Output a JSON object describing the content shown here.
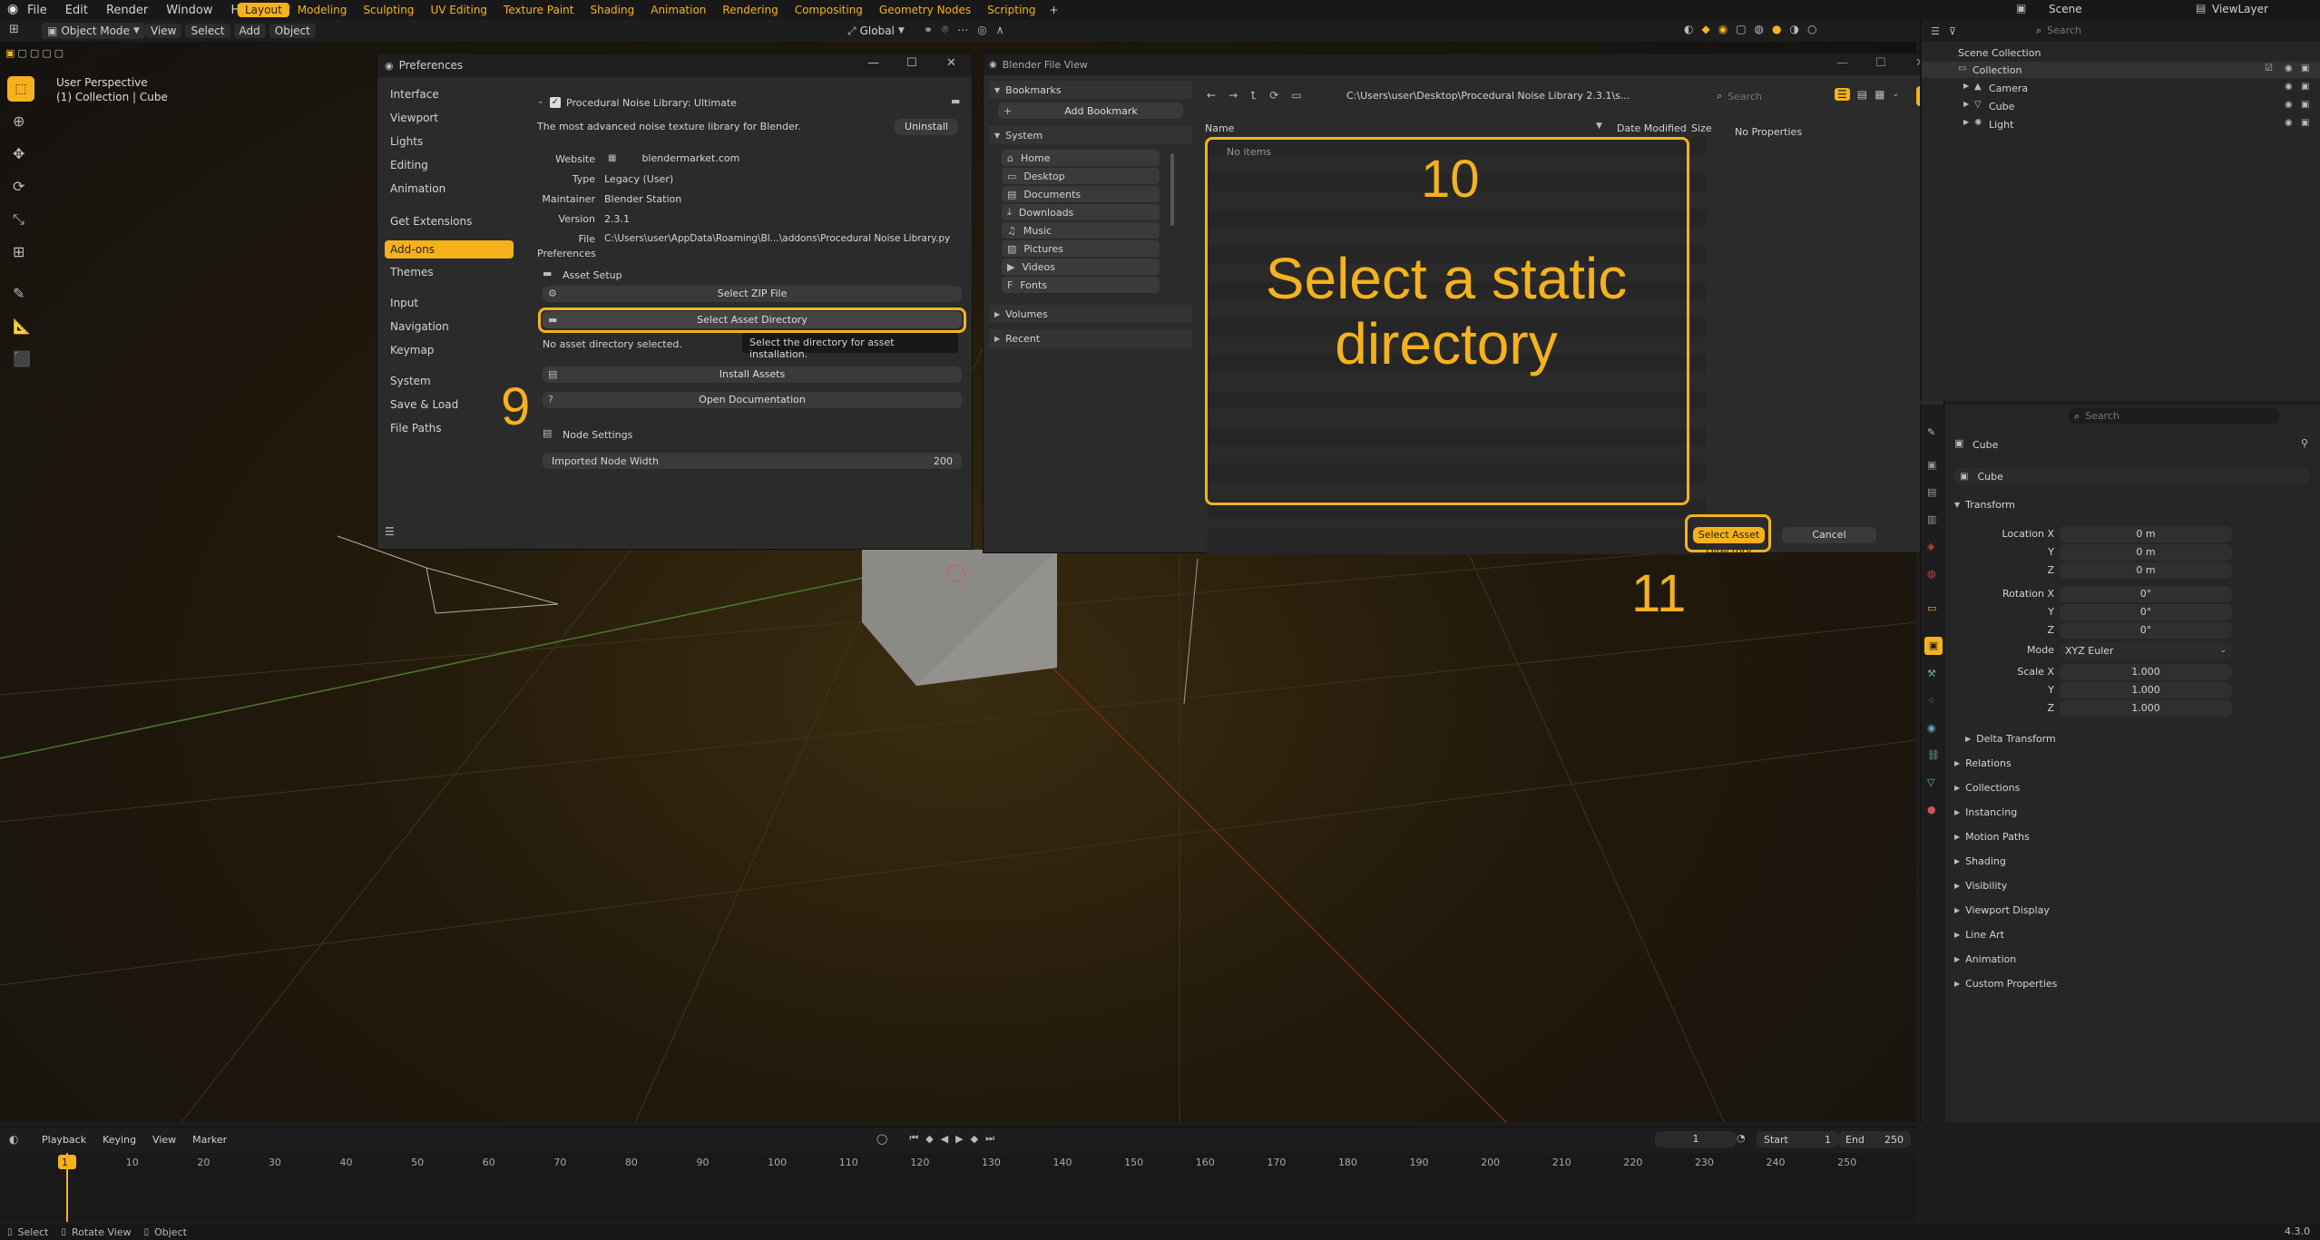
{
  "topbar": {
    "menus": [
      "File",
      "Edit",
      "Render",
      "Window",
      "Help"
    ],
    "tabs": [
      "Layout",
      "Modeling",
      "Sculpting",
      "UV Editing",
      "Texture Paint",
      "Shading",
      "Animation",
      "Rendering",
      "Compositing",
      "Geometry Nodes",
      "Scripting"
    ],
    "add_tab": "+",
    "scene": "Scene",
    "view_layer": "ViewLayer"
  },
  "viewport_header": {
    "mode": "Object Mode",
    "menus": [
      "View",
      "Select",
      "Add",
      "Object"
    ],
    "orientation": "Global"
  },
  "viewport": {
    "perspective": "User Perspective",
    "collection": "(1) Collection | Cube"
  },
  "annotations": {
    "nine": "9",
    "ten": "10",
    "ten_text": "Select a static directory",
    "eleven": "11"
  },
  "preferences": {
    "title": "Preferences",
    "nav": [
      {
        "label": "Interface"
      },
      {
        "label": "Viewport"
      },
      {
        "label": "Lights"
      },
      {
        "label": "Editing"
      },
      {
        "label": "Animation"
      },
      {
        "label": "Get Extensions"
      },
      {
        "label": "Add-ons"
      },
      {
        "label": "Themes"
      },
      {
        "label": "Input"
      },
      {
        "label": "Navigation"
      },
      {
        "label": "Keymap"
      },
      {
        "label": "System"
      },
      {
        "label": "Save & Load"
      },
      {
        "label": "File Paths"
      }
    ],
    "addon_name": "Procedural Noise Library: Ultimate",
    "description": "The most advanced noise texture library for Blender.",
    "uninstall": "Uninstall",
    "website_label": "Website",
    "website": "blendermarket.com",
    "type_label": "Type",
    "type": "Legacy (User)",
    "maintainer_label": "Maintainer",
    "maintainer": "Blender Station",
    "version_label": "Version",
    "version": "2.3.1",
    "file_label": "File",
    "file": "C:\\Users\\user\\AppData\\Roaming\\Bl...\\addons\\Procedural Noise Library.py",
    "prefs_heading": "Preferences",
    "asset_setup": "Asset Setup",
    "select_zip": "Select ZIP File",
    "select_asset_dir": "Select Asset Directory",
    "no_dir": "No asset directory selected.",
    "tooltip": "Select the directory for asset installation.",
    "install_assets": "Install Assets",
    "open_docs": "Open Documentation",
    "node_settings": "Node Settings",
    "node_width_label": "Imported Node Width",
    "node_width": "200"
  },
  "file_view": {
    "title": "Blender File View",
    "bookmarks": "Bookmarks",
    "add_bookmark": "Add Bookmark",
    "system": "System",
    "system_items": [
      {
        "label": "Home",
        "icon": "home-icon"
      },
      {
        "label": "Desktop",
        "icon": "desktop-icon"
      },
      {
        "label": "Documents",
        "icon": "documents-icon"
      },
      {
        "label": "Downloads",
        "icon": "downloads-icon"
      },
      {
        "label": "Music",
        "icon": "music-icon"
      },
      {
        "label": "Pictures",
        "icon": "pictures-icon"
      },
      {
        "label": "Videos",
        "icon": "videos-icon"
      },
      {
        "label": "Fonts",
        "icon": "fonts-icon"
      }
    ],
    "volumes": "Volumes",
    "recent": "Recent",
    "path": "C:\\Users\\user\\Desktop\\Procedural Noise Library 2.3.1\\s...",
    "search_placeholder": "Search",
    "col_name": "Name",
    "col_date": "Date Modified",
    "col_size": "Size",
    "no_items": "No items",
    "no_properties": "No Properties",
    "confirm": "Select Asset Directory",
    "cancel": "Cancel"
  },
  "outliner": {
    "search_placeholder": "Search",
    "scene_collection": "Scene Collection",
    "items": [
      {
        "label": "Collection"
      },
      {
        "label": "Camera"
      },
      {
        "label": "Cube"
      },
      {
        "label": "Light"
      }
    ]
  },
  "properties": {
    "search_placeholder": "Search",
    "object_name": "Cube",
    "data_name": "Cube",
    "transform": "Transform",
    "location_label": "Location X",
    "loc": [
      "0 m",
      "0 m",
      "0 m"
    ],
    "rotation_label": "Rotation X",
    "rot": [
      "0°",
      "0°",
      "0°"
    ],
    "mode_label": "Mode",
    "mode": "XYZ Euler",
    "scale_label": "Scale X",
    "scale": [
      "1.000",
      "1.000",
      "1.000"
    ],
    "y": "Y",
    "z": "Z",
    "panels": [
      "Delta Transform",
      "Relations",
      "Collections",
      "Instancing",
      "Motion Paths",
      "Shading",
      "Visibility",
      "Viewport Display",
      "Line Art",
      "Animation",
      "Custom Properties"
    ]
  },
  "timeline": {
    "menus": [
      "Playback",
      "Keying",
      "View",
      "Marker"
    ],
    "current": "1",
    "start_label": "Start",
    "start": "1",
    "end_label": "End",
    "end": "250",
    "ticks": [
      "1",
      "10",
      "20",
      "30",
      "40",
      "50",
      "60",
      "70",
      "80",
      "90",
      "100",
      "110",
      "120",
      "130",
      "140",
      "150",
      "160",
      "170",
      "180",
      "190",
      "200",
      "210",
      "220",
      "230",
      "240",
      "250"
    ]
  },
  "statusbar": {
    "select": "Select",
    "rotate": "Rotate View",
    "object": "Object",
    "version": "4.3.0"
  },
  "colors": {
    "accent": "#f5b21c",
    "bg": "#1d1d1d",
    "panel": "#303030"
  }
}
